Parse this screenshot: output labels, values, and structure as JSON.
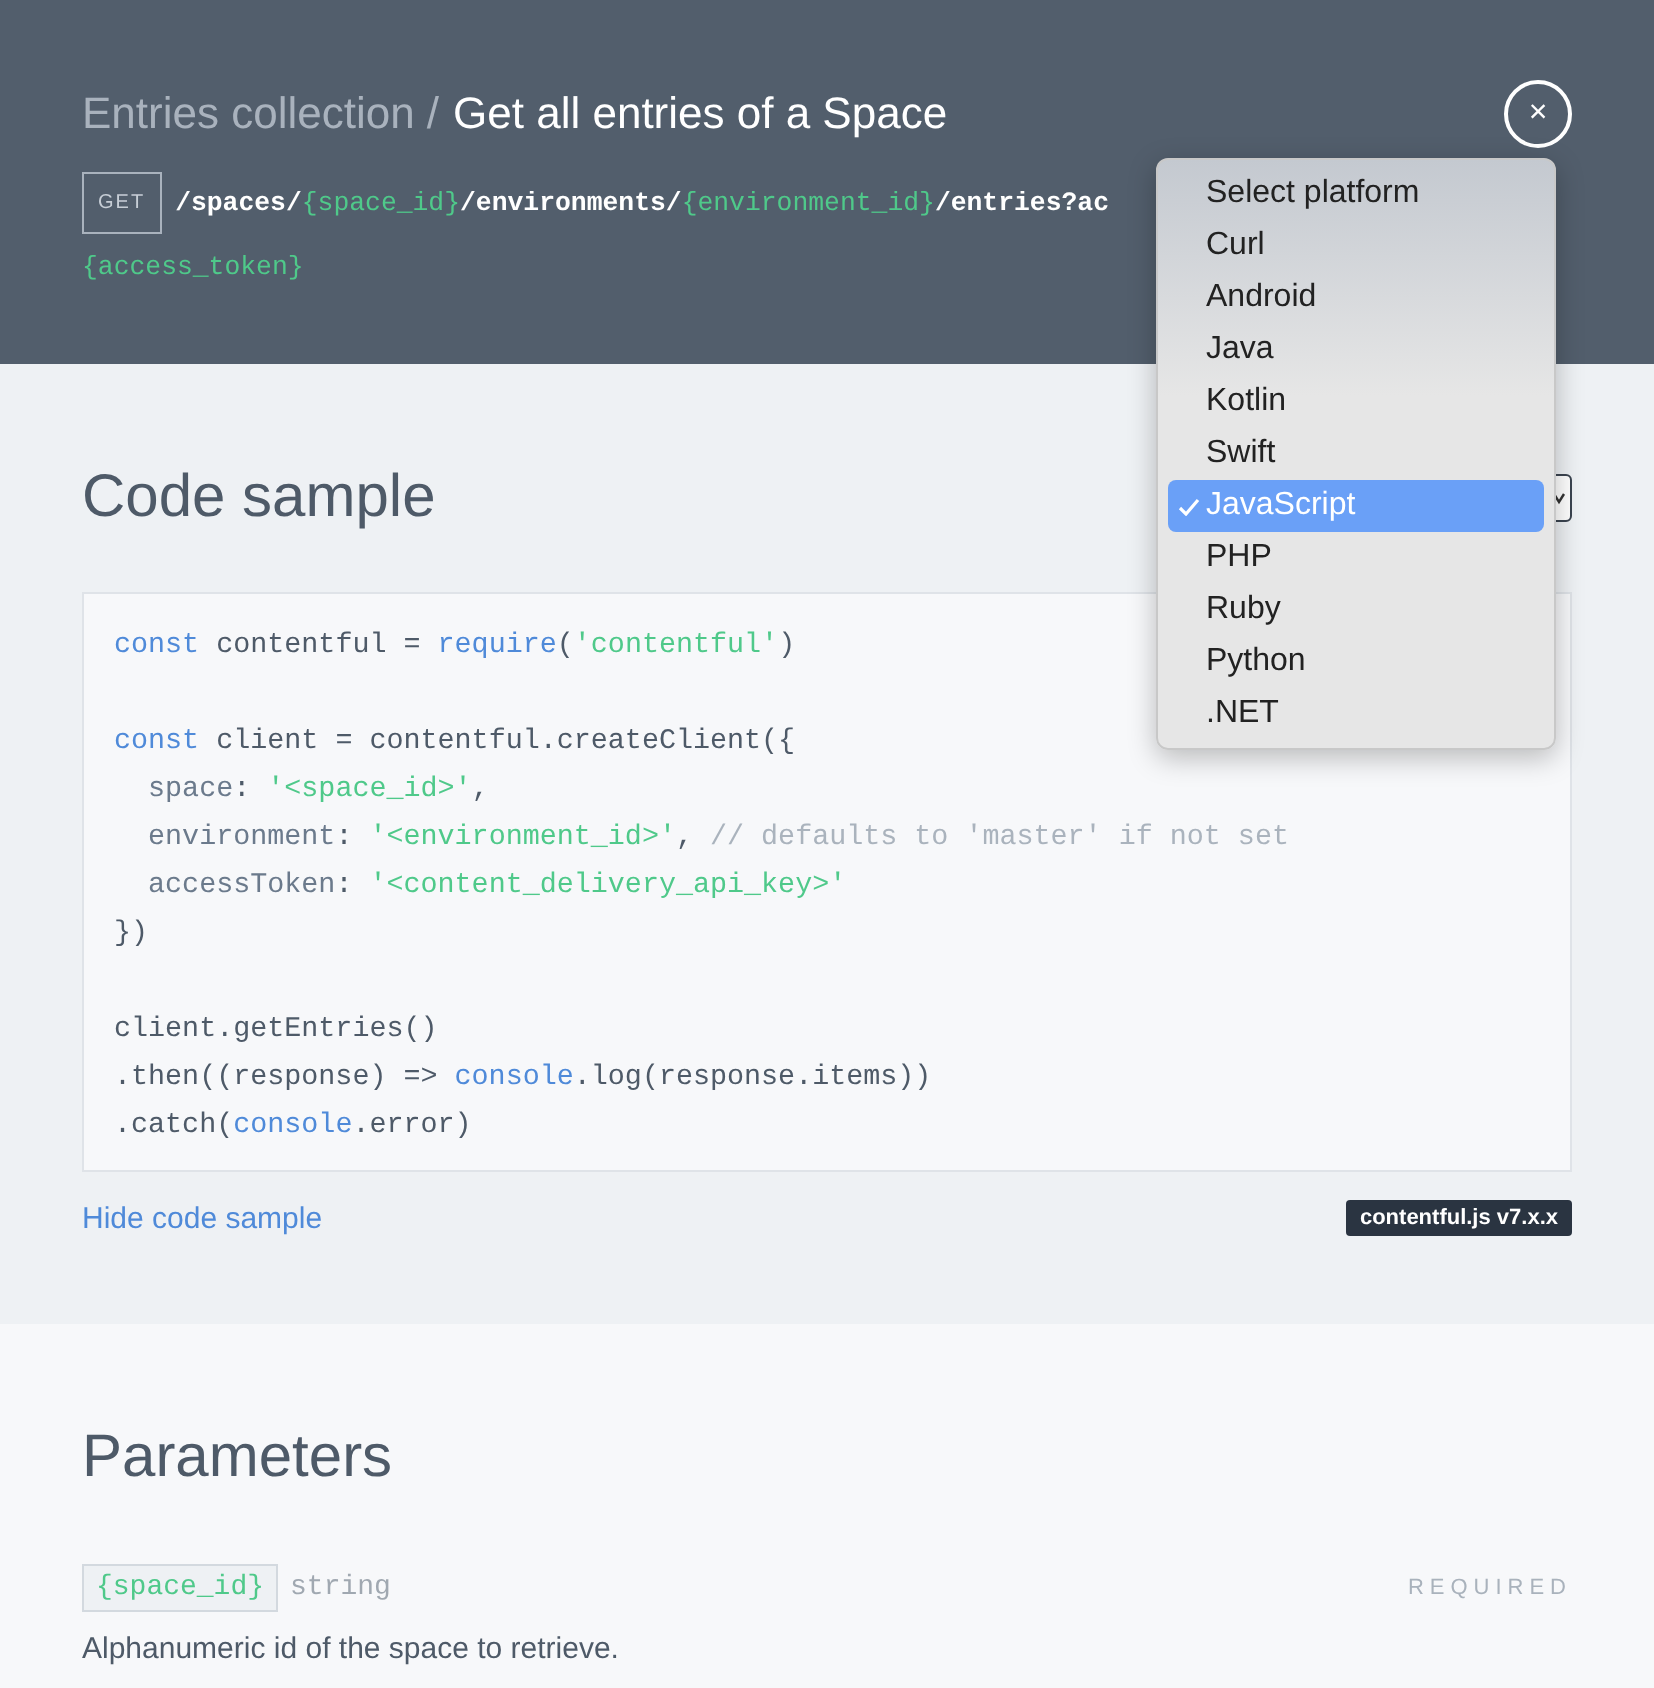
{
  "header": {
    "breadcrumb": "Entries collection /",
    "title": "Get all entries of a Space",
    "method": "GET",
    "url_lines": [
      [
        {
          "text": "/spaces/",
          "kind": "path"
        },
        {
          "text": "{space_id}",
          "kind": "param"
        },
        {
          "text": "/environments/",
          "kind": "path"
        },
        {
          "text": "{environment_id}",
          "kind": "param"
        },
        {
          "text": "/entries?ac",
          "kind": "path"
        }
      ],
      [
        {
          "text": "{access_token}",
          "kind": "param"
        }
      ]
    ],
    "close": "×"
  },
  "code_section": {
    "heading": "Code sample",
    "lines": [
      [
        {
          "text": "const",
          "kind": "keyword"
        },
        {
          "text": " contentful = ",
          "kind": "plain"
        },
        {
          "text": "require",
          "kind": "keyword"
        },
        {
          "text": "(",
          "kind": "plain"
        },
        {
          "text": "'contentful'",
          "kind": "string"
        },
        {
          "text": ")",
          "kind": "plain"
        }
      ],
      {
        "kind": "blank"
      },
      [
        {
          "text": "const",
          "kind": "keyword"
        },
        {
          "text": " client = contentful.createClient({",
          "kind": "plain"
        }
      ],
      [
        {
          "text": "  space",
          "kind": "prop"
        },
        {
          "text": ": ",
          "kind": "plain"
        },
        {
          "text": "'<space_id>'",
          "kind": "string"
        },
        {
          "text": ",",
          "kind": "plain"
        }
      ],
      [
        {
          "text": "  environment",
          "kind": "prop"
        },
        {
          "text": ": ",
          "kind": "plain"
        },
        {
          "text": "'<environment_id>'",
          "kind": "string"
        },
        {
          "text": ", ",
          "kind": "plain"
        },
        {
          "text": "// defaults to 'master' if not set",
          "kind": "comment"
        }
      ],
      [
        {
          "text": "  accessToken",
          "kind": "prop"
        },
        {
          "text": ": ",
          "kind": "plain"
        },
        {
          "text": "'<content_delivery_api_key>'",
          "kind": "string"
        }
      ],
      [
        {
          "text": "})",
          "kind": "plain"
        }
      ],
      {
        "kind": "blank"
      },
      [
        {
          "text": "client.getEntries()",
          "kind": "plain"
        }
      ],
      [
        {
          "text": ".then((response) => ",
          "kind": "plain"
        },
        {
          "text": "console",
          "kind": "keyword"
        },
        {
          "text": ".log(response.items))",
          "kind": "plain"
        }
      ],
      [
        {
          "text": ".catch(",
          "kind": "plain"
        },
        {
          "text": "console",
          "kind": "keyword"
        },
        {
          "text": ".error)",
          "kind": "plain"
        }
      ]
    ],
    "toggle_link": "Hide code sample",
    "version_badge": "contentful.js v7.x.x"
  },
  "platform_menu": [
    {
      "label": "Select platform",
      "selected": false
    },
    {
      "label": "Curl",
      "selected": false
    },
    {
      "label": "Android",
      "selected": false
    },
    {
      "label": "Java",
      "selected": false
    },
    {
      "label": "Kotlin",
      "selected": false
    },
    {
      "label": "Swift",
      "selected": false
    },
    {
      "label": "JavaScript",
      "selected": true
    },
    {
      "label": "PHP",
      "selected": false
    },
    {
      "label": "Ruby",
      "selected": false
    },
    {
      "label": "Python",
      "selected": false
    },
    {
      "label": ".NET",
      "selected": false
    }
  ],
  "parameters": {
    "heading": "Parameters",
    "items": [
      {
        "name": "{space_id}",
        "type": "string",
        "requirement": "REQUIRED",
        "description": "Alphanumeric id of the space to retrieve."
      }
    ]
  }
}
